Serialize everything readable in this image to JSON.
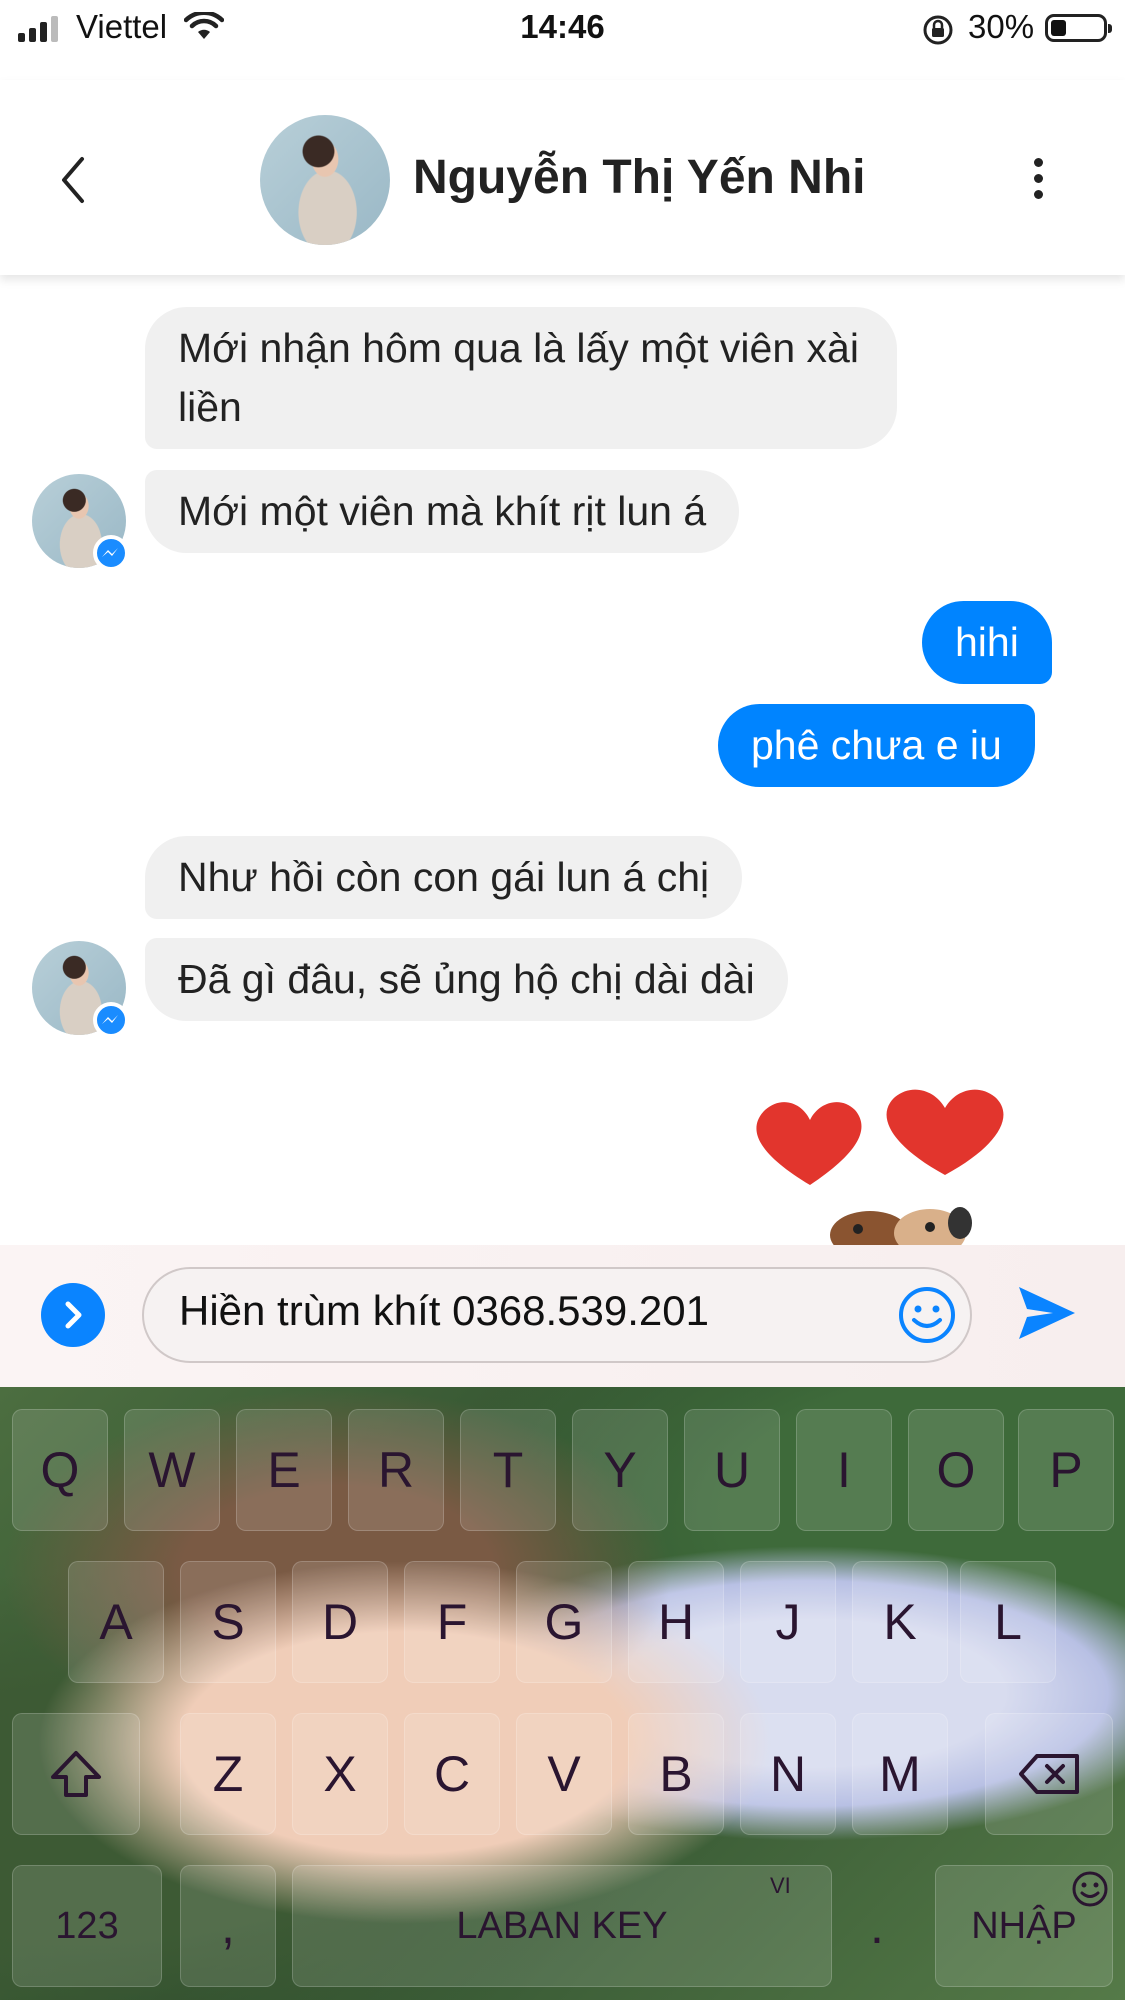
{
  "status_bar": {
    "carrier": "Viettel",
    "time": "14:46",
    "battery_percent": "30%",
    "battery_level": 0.3,
    "icons": [
      "signal-icon",
      "wifi-icon",
      "rotation-lock-icon",
      "battery-icon"
    ]
  },
  "header": {
    "contact_name": "Nguyễn Thị Yến Nhi",
    "icons": [
      "back-chevron-icon",
      "more-vertical-icon"
    ]
  },
  "messages": [
    {
      "direction": "in",
      "text": "Mới nhận hôm qua là lấy một viên xài liền"
    },
    {
      "direction": "in",
      "text": "Mới một viên mà khít rịt lun á"
    },
    {
      "direction": "out",
      "text": "hihi"
    },
    {
      "direction": "out",
      "text": "phê chưa e iu"
    },
    {
      "direction": "in",
      "text": "Như hồi còn con gái lun á chị"
    },
    {
      "direction": "in",
      "text": "Đã gì đâu, sẽ ủng hộ chị dài dài"
    }
  ],
  "sticker": {
    "name": "hearts-puppies-sticker"
  },
  "composer": {
    "input_value": "Hiền trùm khít 0368.539.201",
    "icons": [
      "expand-chevron-icon",
      "emoji-icon",
      "send-icon"
    ]
  },
  "keyboard": {
    "row1": [
      "Q",
      "W",
      "E",
      "R",
      "T",
      "Y",
      "U",
      "I",
      "O",
      "P"
    ],
    "row2": [
      "A",
      "S",
      "D",
      "F",
      "G",
      "H",
      "J",
      "K",
      "L"
    ],
    "row3": [
      "Z",
      "X",
      "C",
      "V",
      "B",
      "N",
      "M"
    ],
    "numbers_key": "123",
    "comma_key": ",",
    "space_key": "LABAN KEY",
    "language_tag": "VI",
    "period_key": ".",
    "enter_key": "NHẬP",
    "icons": [
      "shift-icon",
      "backspace-icon",
      "smiley-icon"
    ]
  },
  "colors": {
    "outgoing_bubble": "#0084ff",
    "incoming_bubble": "#f0f0f0",
    "messenger_blue": "#0a84ff"
  }
}
